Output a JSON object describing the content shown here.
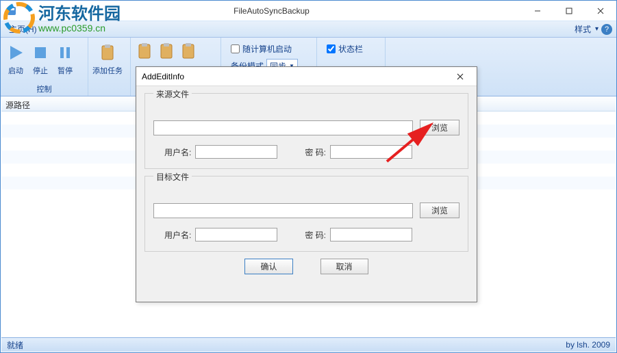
{
  "window": {
    "title": "FileAutoSyncBackup"
  },
  "menubar": {
    "home": "主页(H)",
    "style": "样式"
  },
  "ribbon": {
    "group_control": "控制",
    "btn_start": "启动",
    "btn_stop": "停止",
    "btn_pause": "暂停",
    "btn_add_task": "添加任务",
    "chk_start_with_computer": "随计算机启动",
    "lbl_backup_mode": "备份模式",
    "select_backup_mode_value": "同步",
    "chk_statusbar": "状态栏"
  },
  "content": {
    "header_source_path": "源路径"
  },
  "statusbar": {
    "ready": "就绪",
    "author": "by lsh. 2009"
  },
  "dialog": {
    "title": "AddEditInfo",
    "group_source": "来源文件",
    "group_target": "目标文件",
    "btn_browse": "浏览",
    "lbl_username": "用户名:",
    "lbl_password": "密  码:",
    "btn_ok": "确认",
    "btn_cancel": "取消",
    "source_path": "",
    "source_user": "",
    "source_pwd": "",
    "target_path": "",
    "target_user": "",
    "target_pwd": ""
  },
  "watermark": {
    "line1": "河东软件园",
    "line2": "www.pc0359.cn"
  }
}
